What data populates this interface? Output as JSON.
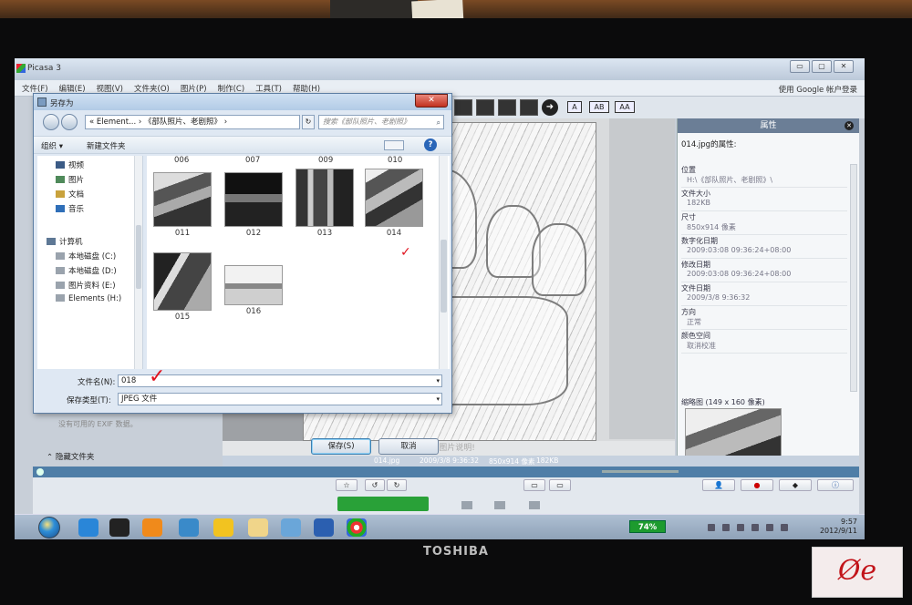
{
  "monitor": {
    "brand": "TOSHIBA",
    "stamp_text": "Øe"
  },
  "picasa": {
    "title": "Picasa 3",
    "window_buttons": [
      "▭",
      "▢",
      "✕"
    ],
    "menu": [
      "文件(F)",
      "编辑(E)",
      "视图(V)",
      "文件夹(O)",
      "图片(P)",
      "制作(C)",
      "工具(T)",
      "帮助(H)"
    ],
    "google_link": "使用 Google 帐户登录",
    "mode_buttons": [
      "A",
      "AB",
      "AA"
    ],
    "exif_note": "没有可用的 EXIF 数据。",
    "caption": "制作图片说明!",
    "status": {
      "file": "014.jpg",
      "date": "2009/3/8 9:36:32",
      "dims": "850x914 像素",
      "size": "182KB"
    }
  },
  "properties": {
    "title": "属性",
    "file_of": "014.jpg的属性:",
    "rows": [
      {
        "key": "位置",
        "value": "H:\\《部队照片、老剧照》\\"
      },
      {
        "key": "文件大小",
        "value": "182KB"
      },
      {
        "key": "尺寸",
        "value": "850x914 像素"
      },
      {
        "key": "数字化日期",
        "value": "2009:03:08 09:36:24+08:00"
      },
      {
        "key": "修改日期",
        "value": "2009:03:08 09:36:24+08:00"
      },
      {
        "key": "文件日期",
        "value": "2009/3/8 9:36:32"
      },
      {
        "key": "方向",
        "value": "正常"
      },
      {
        "key": "颜色空间",
        "value": "取消校准"
      }
    ],
    "thumb_label": "缩略图 (149 x 160 像素)"
  },
  "dialog": {
    "title": "另存为",
    "close": "✕",
    "address": "« Element... › 《部队照片、老剧照》 ›",
    "search_placeholder": "搜索《部队照片、老剧照》",
    "search_glyph": "⌕",
    "refresh": "↻",
    "organize": "组织 ▾",
    "new_folder": "新建文件夹",
    "help": "?",
    "nav_items": [
      {
        "label": "视频",
        "color": "#3b5b86"
      },
      {
        "label": "图片",
        "color": "#4f8a5a"
      },
      {
        "label": "文档",
        "color": "#c9a23c"
      },
      {
        "label": "音乐",
        "color": "#2f6fb8"
      },
      {
        "label": "计算机",
        "color": "#5e7895"
      },
      {
        "label": "本地磁盘 (C:)",
        "color": "#9aa3ad"
      },
      {
        "label": "本地磁盘 (D:)",
        "color": "#9aa3ad"
      },
      {
        "label": "图片资料 (E:)",
        "color": "#9aa3ad"
      },
      {
        "label": "Elements (H:)",
        "color": "#9aa3ad"
      }
    ],
    "top_labels": [
      "006",
      "007",
      "009",
      "010"
    ],
    "files": [
      "011",
      "012",
      "013",
      "014",
      "015",
      "016"
    ],
    "filename_label": "文件名(N):",
    "filename_value": "018",
    "filetype_label": "保存类型(T):",
    "filetype_value": "JPEG 文件",
    "hide_folders": "隐藏文件夹",
    "save": "保存(S)",
    "cancel": "取消"
  },
  "annotations": {
    "check": "✓"
  },
  "taskbar": {
    "battery": "74%",
    "time": "9:57",
    "date": "2012/9/11"
  }
}
